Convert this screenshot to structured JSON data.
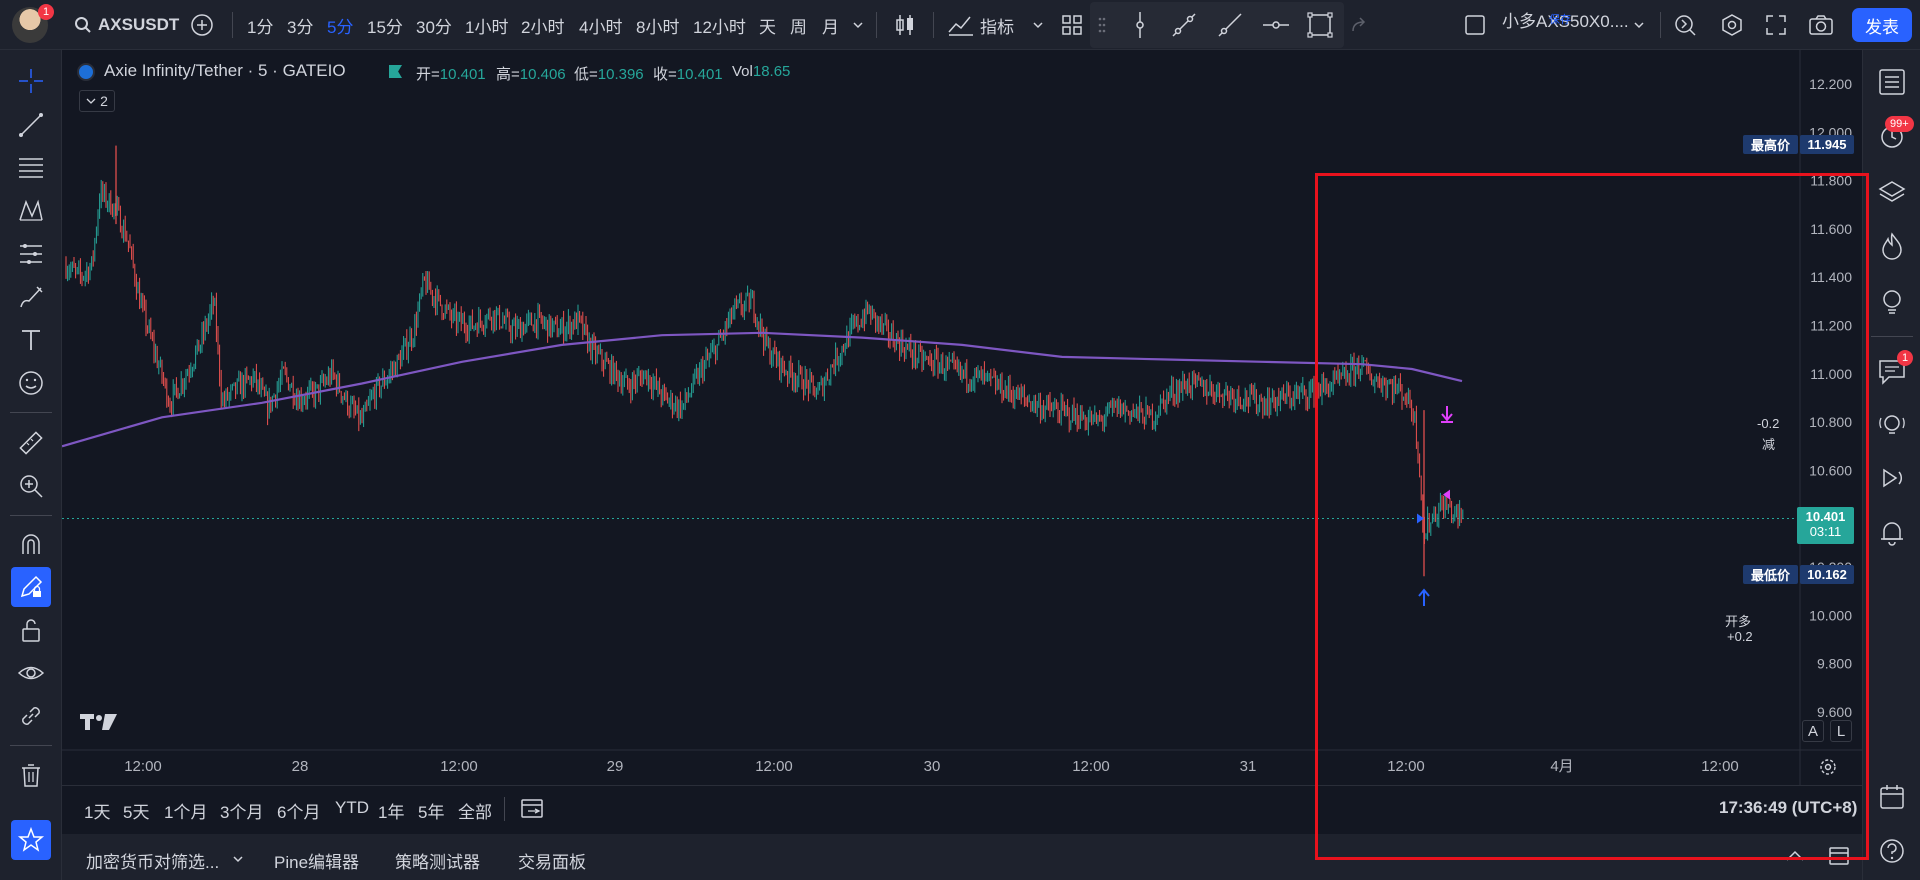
{
  "topbar": {
    "notification_count": "1",
    "symbol": "AXSUSDT",
    "timeframes": [
      "1分",
      "3分",
      "5分",
      "15分",
      "30分",
      "1小时",
      "2小时",
      "4小时",
      "8小时",
      "12小时",
      "天",
      "周",
      "月"
    ],
    "active_timeframe": "5分",
    "indicators_label": "指标",
    "layout_name": "小多AXS50X0....",
    "layout_saved": "保存",
    "publish_label": "发表"
  },
  "legend": {
    "title": "Axie Infinity/Tether · 5 · GATEIO",
    "open_label": "开=",
    "open": "10.401",
    "high_label": "高=",
    "high": "10.406",
    "low_label": "低=",
    "low": "10.396",
    "close_label": "收=",
    "close": "10.401",
    "vol_label": "Vol",
    "vol": "18.65",
    "collapse_count": "2"
  },
  "price_axis": {
    "labels": [
      "12.200",
      "12.000",
      "11.800",
      "11.600",
      "11.400",
      "11.200",
      "11.000",
      "10.800",
      "10.600",
      "10.400",
      "10.200",
      "10.000",
      "9.800",
      "9.600"
    ],
    "high_label": "最高价",
    "high_value": "11.945",
    "low_label": "最低价",
    "low_value": "10.162",
    "current_price": "10.401",
    "countdown": "03:11",
    "auto_btn": "A",
    "log_btn": "L"
  },
  "time_axis": {
    "labels": [
      "12:00",
      "28",
      "12:00",
      "29",
      "12:00",
      "30",
      "12:00",
      "31",
      "12:00",
      "4月",
      "12:00"
    ]
  },
  "annotations": {
    "sell_value": "-0.2",
    "sell_label": "减",
    "buy_label": "开多",
    "buy_value": "+0.2"
  },
  "range_bar": {
    "ranges": [
      "1天",
      "5天",
      "1个月",
      "3个月",
      "6个月",
      "YTD",
      "1年",
      "5年",
      "全部"
    ],
    "clock": "17:36:49 (UTC+8)"
  },
  "panel_tabs": [
    "加密货币对筛选...",
    "Pine编辑器",
    "策略测试器",
    "交易面板"
  ],
  "right_sidebar": {
    "alerts_badge": "99+",
    "chat_badge": "1"
  },
  "colors": {
    "up": "#26a69a",
    "down": "#ef5350",
    "ma": "#7e57c2",
    "accent": "#2962ff",
    "highlight": "#e8121d"
  }
}
